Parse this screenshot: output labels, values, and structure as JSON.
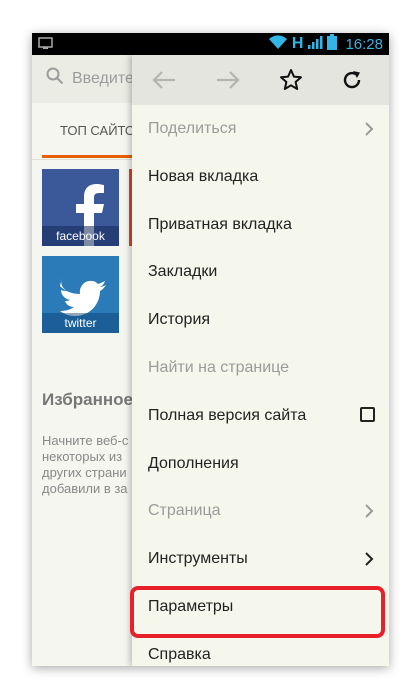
{
  "status_bar": {
    "time": "16:28",
    "network_type": "H",
    "icons": [
      "screen-icon",
      "wifi-icon",
      "signal-icon",
      "battery-icon"
    ]
  },
  "browser": {
    "search_placeholder": "Введите",
    "tab_top_sites": "ТОП САЙТОВ",
    "tiles": [
      {
        "label": "facebook",
        "color": "#3b5998"
      },
      {
        "label": "twitter",
        "color": "#2b7bb9"
      }
    ],
    "favorites_title": "Избранное",
    "favorites_text": [
      "Начните веб-с",
      "некоторых из",
      "других страни",
      "добавили в за"
    ]
  },
  "menu": {
    "nav_icons": [
      "back-arrow-icon",
      "forward-arrow-icon",
      "star-icon",
      "reload-icon"
    ],
    "items": [
      {
        "label": "Поделиться",
        "disabled": true,
        "trailing": "chevron"
      },
      {
        "label": "Новая вкладка",
        "disabled": false,
        "trailing": "none"
      },
      {
        "label": "Приватная вкладка",
        "disabled": false,
        "trailing": "none"
      },
      {
        "label": "Закладки",
        "disabled": false,
        "trailing": "none"
      },
      {
        "label": "История",
        "disabled": false,
        "trailing": "none"
      },
      {
        "label": "Найти на странице",
        "disabled": true,
        "trailing": "none"
      },
      {
        "label": "Полная версия сайта",
        "disabled": false,
        "trailing": "checkbox"
      },
      {
        "label": "Дополнения",
        "disabled": false,
        "trailing": "none"
      },
      {
        "label": "Страница",
        "disabled": true,
        "trailing": "chevron"
      },
      {
        "label": "Инструменты",
        "disabled": false,
        "trailing": "chevron"
      },
      {
        "label": "Параметры",
        "disabled": false,
        "trailing": "none",
        "highlighted": true
      },
      {
        "label": "Справка",
        "disabled": false,
        "trailing": "none"
      }
    ]
  },
  "colors": {
    "highlight": "#e8202a",
    "accent": "#e66000",
    "status_blue": "#33b5e5"
  }
}
